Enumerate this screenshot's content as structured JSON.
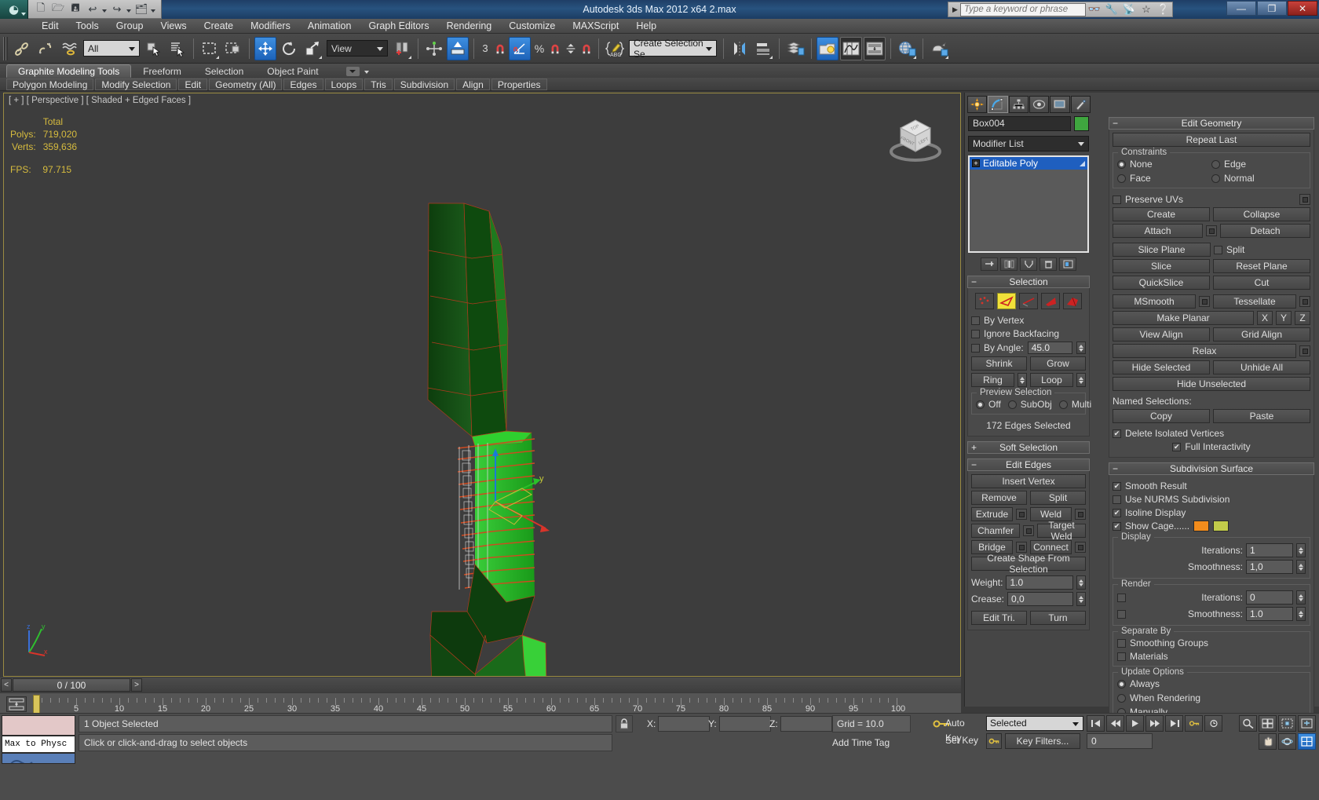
{
  "title": {
    "app_title": "Autodesk 3ds Max  2012 x64     2.max",
    "logo_icon": "3dsmax-logo-icon",
    "quick_access": [
      {
        "name": "new-file-icon",
        "glyph": "🗋"
      },
      {
        "name": "open-file-icon",
        "glyph": "🗁"
      },
      {
        "name": "save-file-icon",
        "glyph": "💾"
      },
      {
        "name": "undo-icon",
        "glyph": "↩"
      },
      {
        "name": "redo-icon",
        "glyph": "↪"
      },
      {
        "name": "set-project-folder-icon",
        "glyph": "🗂"
      }
    ],
    "search_placeholder": "Type a keyword or phrase",
    "search_value": "",
    "help_icons": [
      "binoculars-icon",
      "wrench-icon",
      "satellite-icon",
      "star-icon",
      "question-icon"
    ],
    "window_buttons": {
      "minimize": "—",
      "restore": "❐",
      "close": "✕"
    }
  },
  "menu": {
    "items": [
      "Edit",
      "Tools",
      "Group",
      "Views",
      "Create",
      "Modifiers",
      "Animation",
      "Graph Editors",
      "Rendering",
      "Customize",
      "MAXScript",
      "Help"
    ]
  },
  "toolbar": {
    "selection_filter": "All",
    "named_selection_sets": "Create Selection Se",
    "reference_coord_system": "View",
    "snap_angle_label": "3",
    "percent_label": "%",
    "icons": [
      "select-and-link-icon",
      "unlink-selection-icon",
      "bind-to-space-warp-icon",
      "select-object-icon",
      "select-by-name-icon",
      "rectangular-selection-region-icon",
      "window-crossing-icon",
      "select-and-move-icon",
      "select-and-rotate-icon",
      "select-and-uniform-scale-icon",
      "use-pivot-point-center-icon",
      "select-and-manipulate-icon",
      "snaps-toggle-icon",
      "angle-snap-toggle-icon",
      "percent-snap-toggle-icon",
      "spinner-snap-toggle-icon",
      "edit-named-selection-sets-icon",
      "mirror-icon",
      "align-icon",
      "layer-manager-icon",
      "curve-editor-icon",
      "schematic-view-icon",
      "material-editor-icon",
      "render-setup-icon",
      "rendered-frame-window-icon",
      "render-production-icon"
    ]
  },
  "ribbon": {
    "tabs": [
      {
        "label": "Graphite Modeling Tools",
        "active": true
      },
      {
        "label": "Freeform",
        "active": false
      },
      {
        "label": "Selection",
        "active": false
      },
      {
        "label": "Object Paint",
        "active": false
      }
    ],
    "panels": [
      "Polygon Modeling",
      "Modify Selection",
      "Edit",
      "Geometry (All)",
      "Edges",
      "Loops",
      "Tris",
      "Subdivision",
      "Align",
      "Properties"
    ]
  },
  "viewport": {
    "label": "[ + ] [ Perspective ] [ Shaded + Edged Faces ]",
    "stats": {
      "total_header": "Total",
      "polys_label": "Polys:",
      "polys_value": "719,020",
      "verts_label": "Verts:",
      "verts_value": "359,636",
      "fps_label": "FPS:",
      "fps_value": "97.715"
    },
    "viewcube_faces": {
      "top": "TOP",
      "front": "FRONT",
      "right": "LEFT"
    },
    "axis_labels": {
      "z": "z",
      "y": "y",
      "x": "x"
    },
    "gizmo_axis_labels": {
      "y": "y"
    }
  },
  "command_panel": {
    "tabs": [
      "create-tab-icon",
      "modify-tab-icon",
      "hierarchy-tab-icon",
      "motion-tab-icon",
      "display-tab-icon",
      "utilities-tab-icon"
    ],
    "active_tab_index": 1,
    "object_name": "Box004",
    "object_color": "#3fa63f",
    "modifier_list_label": "Modifier List",
    "stack": [
      {
        "label": "Editable Poly",
        "selected": true
      }
    ],
    "selection_rollout": {
      "title": "Selection",
      "checkboxes": [
        {
          "label": "By Vertex",
          "checked": false
        },
        {
          "label": "Ignore Backfacing",
          "checked": false
        },
        {
          "label": "By Angle:",
          "checked": false
        }
      ],
      "by_angle_value": "45.0",
      "buttons": [
        "Shrink",
        "Grow",
        "Ring",
        "Loop"
      ],
      "preview_selection_label": "Preview Selection",
      "preview_options": [
        {
          "label": "Off",
          "selected": true
        },
        {
          "label": "SubObj",
          "selected": false
        },
        {
          "label": "Multi",
          "selected": false
        }
      ],
      "status": "172 Edges Selected"
    },
    "soft_selection_rollout": {
      "title": "Soft Selection"
    },
    "edit_edges_rollout": {
      "title": "Edit Edges",
      "buttons": [
        {
          "label": "Insert Vertex",
          "settings": false
        },
        {
          "label": "Remove",
          "settings": false
        },
        {
          "label": "Split",
          "settings": false
        },
        {
          "label": "Extrude",
          "settings": true
        },
        {
          "label": "Weld",
          "settings": true
        },
        {
          "label": "Chamfer",
          "settings": true
        },
        {
          "label": "Target Weld",
          "settings": false
        },
        {
          "label": "Bridge",
          "settings": true
        },
        {
          "label": "Connect",
          "settings": true
        },
        {
          "label": "Create Shape From Selection",
          "settings": false
        }
      ],
      "weight_label": "Weight:",
      "weight_value": "1.0",
      "crease_label": "Crease:",
      "crease_value": "0,0",
      "edit_tri_label": "Edit Tri.",
      "turn_label": "Turn"
    },
    "edit_geometry_rollout": {
      "title": "Edit Geometry",
      "repeat_last": "Repeat Last",
      "constraints_label": "Constraints",
      "constraints": [
        {
          "label": "None",
          "selected": true
        },
        {
          "label": "Edge",
          "selected": false
        },
        {
          "label": "Face",
          "selected": false
        },
        {
          "label": "Normal",
          "selected": false
        }
      ],
      "preserve_uvs": {
        "label": "Preserve UVs",
        "checked": false
      },
      "buttons": [
        "Create",
        "Collapse",
        "Attach",
        "Detach",
        "Slice Plane",
        "Slice",
        "Reset Plane",
        "QuickSlice",
        "Cut",
        "MSmooth",
        "Tessellate",
        "Make Planar",
        "View Align",
        "Grid Align",
        "Relax",
        "Hide Selected",
        "Unhide All",
        "Hide Unselected"
      ],
      "split_label": "Split",
      "split_checked": false,
      "make_planar_axes": [
        "X",
        "Y",
        "Z"
      ],
      "named_selections_label": "Named Selections:",
      "copy_label": "Copy",
      "paste_label": "Paste",
      "delete_isolated": {
        "label": "Delete Isolated Vertices",
        "checked": true
      },
      "full_interactivity": {
        "label": "Full Interactivity",
        "checked": true
      }
    },
    "subdivision_rollout": {
      "title": "Subdivision Surface",
      "smooth_result": {
        "label": "Smooth Result",
        "checked": true
      },
      "use_nurms": {
        "label": "Use NURMS Subdivision",
        "checked": false
      },
      "isoline_display": {
        "label": "Isoline Display",
        "checked": true
      },
      "show_cage": {
        "label": "Show Cage......",
        "checked": true,
        "color1": "#f28c1c",
        "color2": "#c2cc4a"
      },
      "display_label": "Display",
      "display_iterations_label": "Iterations:",
      "display_iterations_value": "1",
      "display_smoothness_label": "Smoothness:",
      "display_smoothness_value": "1,0",
      "render_label": "Render",
      "render_iterations_label": "Iterations:",
      "render_iterations_value": "0",
      "render_smoothness_label": "Smoothness:",
      "render_smoothness_value": "1.0",
      "separate_by_label": "Separate By",
      "smoothing_groups": {
        "label": "Smoothing Groups",
        "checked": false
      },
      "materials": {
        "label": "Materials",
        "checked": false
      },
      "update_options_label": "Update Options",
      "update_options": [
        {
          "label": "Always",
          "selected": true
        },
        {
          "label": "When Rendering",
          "selected": false
        },
        {
          "label": "Manually",
          "selected": false
        }
      ]
    }
  },
  "timeline": {
    "current_frame_display": "0 / 100",
    "prev_arrow": "<",
    "next_arrow": ">",
    "ruler_labels": [
      "5",
      "10",
      "15",
      "20",
      "25",
      "30",
      "35",
      "40",
      "45",
      "50",
      "55",
      "60",
      "65",
      "70",
      "75",
      "80",
      "85",
      "90",
      "95",
      "100"
    ],
    "current_frame": 0
  },
  "status_bar": {
    "maxscript_mini_listener_label": "Max to Physc",
    "selection_status": "1 Object Selected",
    "prompt": "Click or click-and-drag to select objects",
    "lock_icon": "lock-selection-icon",
    "coords": [
      {
        "axis": "X:",
        "value": ""
      },
      {
        "axis": "Y:",
        "value": ""
      },
      {
        "axis": "Z:",
        "value": ""
      }
    ],
    "grid": "Grid = 10.0",
    "add_time_tag": "Add Time Tag",
    "key_icon": "key-mode-toggle-icon",
    "auto_key_label": "Auto Key",
    "set_key_label": "Set Key",
    "filter_selection": "Selected",
    "key_filters_label": "Key Filters...",
    "frame_value": "0",
    "transport_icons": [
      "go-to-start-icon",
      "previous-frame-icon",
      "play-animation-icon",
      "next-frame-icon",
      "go-to-end-icon",
      "key-mode-icon",
      "time-configuration-icon"
    ],
    "nav_icons_row1": [
      "zoom-icon",
      "zoom-all-icon",
      "zoom-extents-icon",
      "zoom-region-icon"
    ],
    "nav_icons_row2": [
      "pan-view-icon",
      "orbit-icon",
      "maximize-viewport-toggle-icon"
    ]
  }
}
